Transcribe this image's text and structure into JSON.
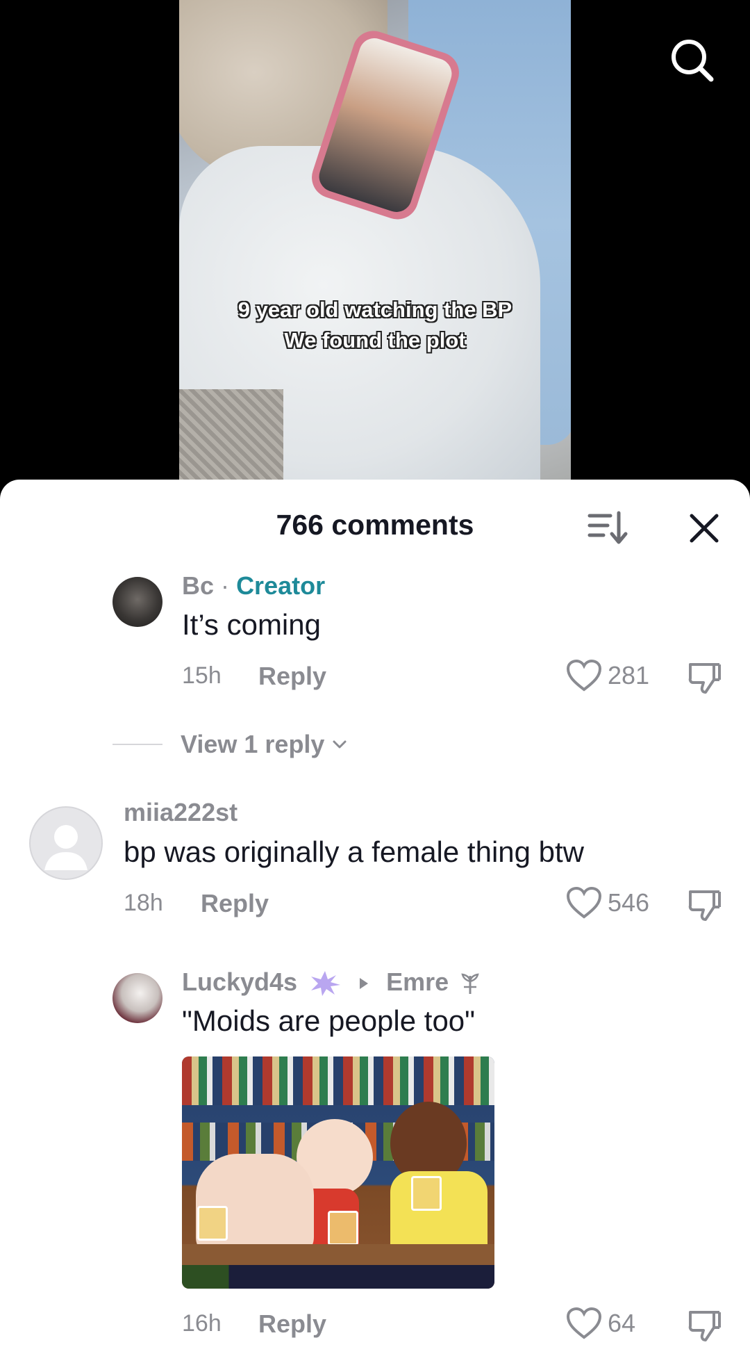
{
  "video": {
    "caption_lines": [
      "9 year old watching the BP",
      "We found the plot"
    ]
  },
  "header": {
    "search_icon": "search-icon"
  },
  "sheet": {
    "title": "766 comments",
    "sort_icon": "sort-icon",
    "close_icon": "close-icon"
  },
  "comments": [
    {
      "username": "Bc",
      "separator": "·",
      "badge": "Creator",
      "text": "It’s coming",
      "time": "15h",
      "reply_label": "Reply",
      "likes": "281",
      "view_replies": "View 1 reply"
    },
    {
      "username": "miia222st",
      "text": "bp was originally a female thing btw",
      "time": "18h",
      "reply_label": "Reply",
      "likes": "546"
    },
    {
      "username": "Luckyd4s",
      "reply_to": "Emre",
      "text": "\"Moids are people too\"",
      "time": "16h",
      "reply_label": "Reply",
      "likes": "64"
    }
  ],
  "colors": {
    "accent_creator": "#1e8a99",
    "text_primary": "#161823",
    "text_secondary": "#8a8b91"
  }
}
